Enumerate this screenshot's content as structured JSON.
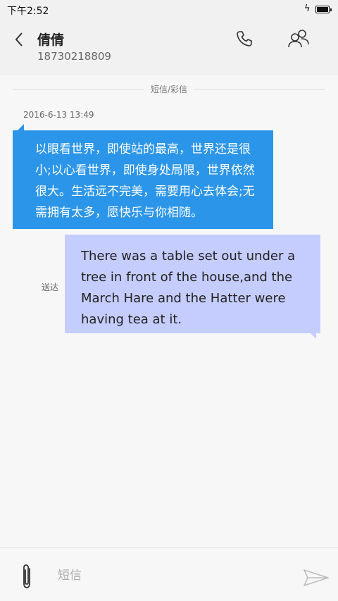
{
  "status_bar": {
    "time": "下午2:52"
  },
  "header": {
    "contact_name": "倩倩",
    "contact_number": "18730218809"
  },
  "thread": {
    "type_label": "短信/彩信",
    "timestamp": "2016-6-13 13:49",
    "received_message": "以眼看世界，即使站的最高，世界还是很小;以心看世界，即使身处局限，世界依然很大。生活远不完美，需要用心去体会;无需拥有太多，愿快乐与你相随。",
    "sent_message": "There was a table set out under a tree in front of the house,and the March Hare and the Hatter were having tea at it.",
    "sent_status": "送达"
  },
  "composer": {
    "placeholder": "短信"
  },
  "colors": {
    "received_bubble": "#2b95e9",
    "sent_bubble": "#c5cdff"
  },
  "icons": [
    "back-icon",
    "phone-icon",
    "contacts-icon",
    "flash-icon",
    "battery-icon",
    "paperclip-icon",
    "send-icon"
  ]
}
